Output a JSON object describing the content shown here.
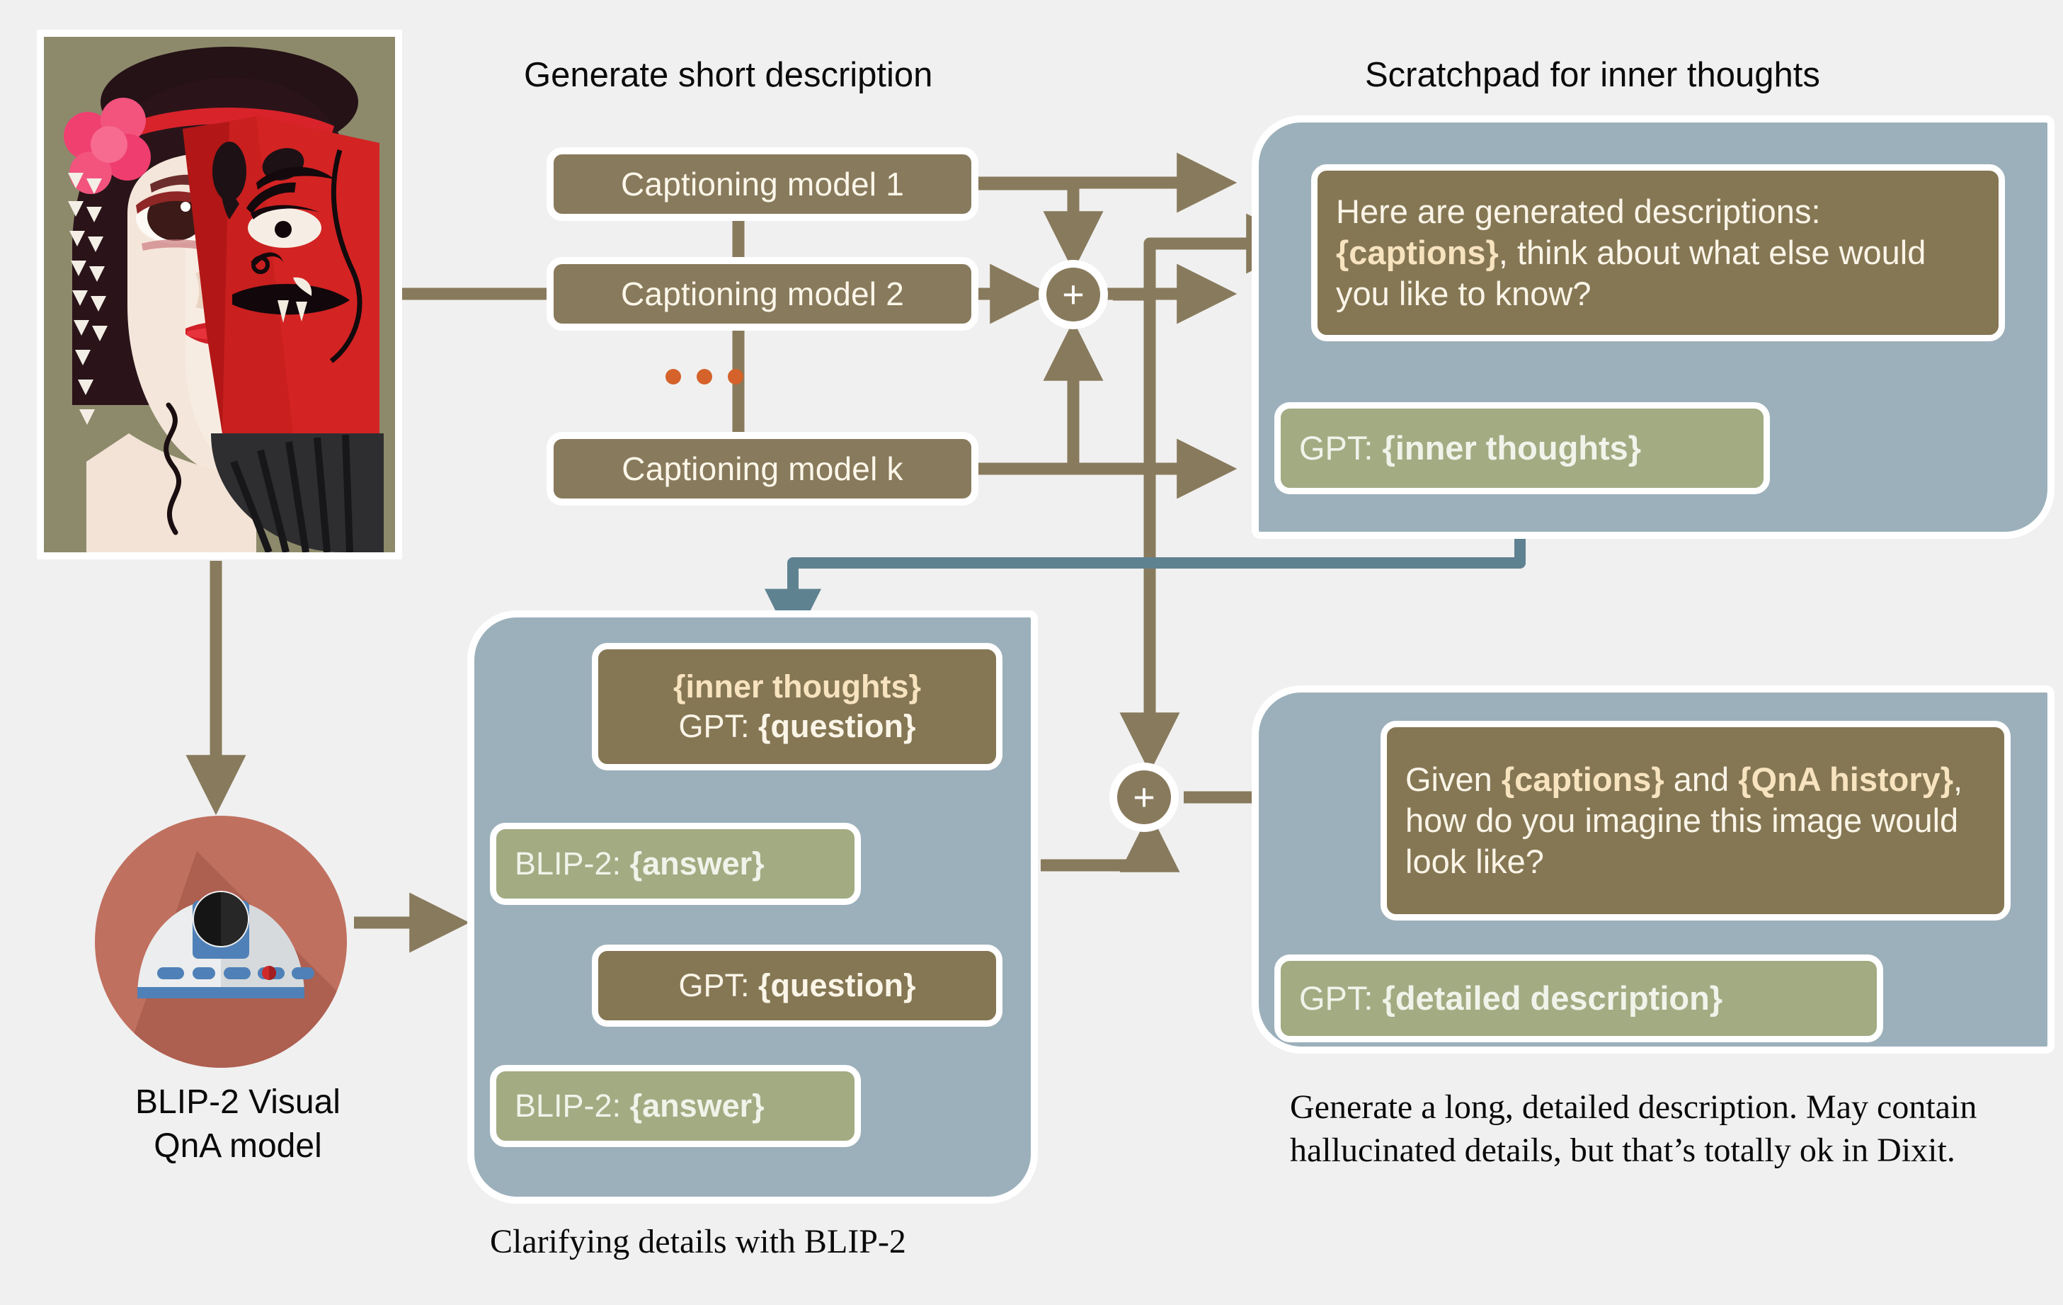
{
  "headings": {
    "generate_short_description": "Generate short description",
    "scratchpad_for_inner_thoughts": "Scratchpad for inner thoughts"
  },
  "captioning": {
    "models": [
      {
        "label": "Captioning model  1"
      },
      {
        "label": "Captioning model 2"
      },
      {
        "label": "Captioning model k"
      }
    ],
    "ellipsis": "•••"
  },
  "scratchpad_panel": {
    "prompt": {
      "pre": "Here are generated descriptions: ",
      "variable": "{captions}",
      "post": ", think about what else would you like to know?"
    },
    "response": {
      "speaker": "GPT: ",
      "variable": "{inner thoughts}"
    }
  },
  "blip2_panel": {
    "caption": "Clarifying details with BLIP-2",
    "turns": [
      {
        "line1": "{inner thoughts}",
        "speaker": "GPT: ",
        "variable": "{question}"
      },
      {
        "speaker": "BLIP-2: ",
        "variable": "{answer}"
      },
      {
        "speaker": "GPT: ",
        "variable": "{question}"
      },
      {
        "speaker": "BLIP-2: ",
        "variable": "{answer}"
      }
    ]
  },
  "detailed_panel": {
    "prompt": {
      "pre": "Given ",
      "variable1": "{captions}",
      "mid": " and ",
      "variable2": "{QnA history}",
      "post": ", how do you imagine this image would look like?"
    },
    "response": {
      "speaker": "GPT: ",
      "variable": "{detailed description}"
    },
    "note": "Generate a long, detailed description. May contain hallucinated details, but that’s totally ok in Dixit."
  },
  "blip2_model": {
    "label_line1": "BLIP-2 Visual",
    "label_line2": "QnA model"
  },
  "junctions": {
    "plus_symbol": "+"
  },
  "colors": {
    "background": "#f0f0f0",
    "panel": "#9cb0bb",
    "brown_bubble": "#857754",
    "green_bubble": "#a2ab82",
    "arrow_brown": "#887a5c",
    "arrow_teal": "#5f8291",
    "highlight_text": "#f8e3bf",
    "dot_orange": "#d4622a",
    "avatar_circle": "#c0705f"
  }
}
